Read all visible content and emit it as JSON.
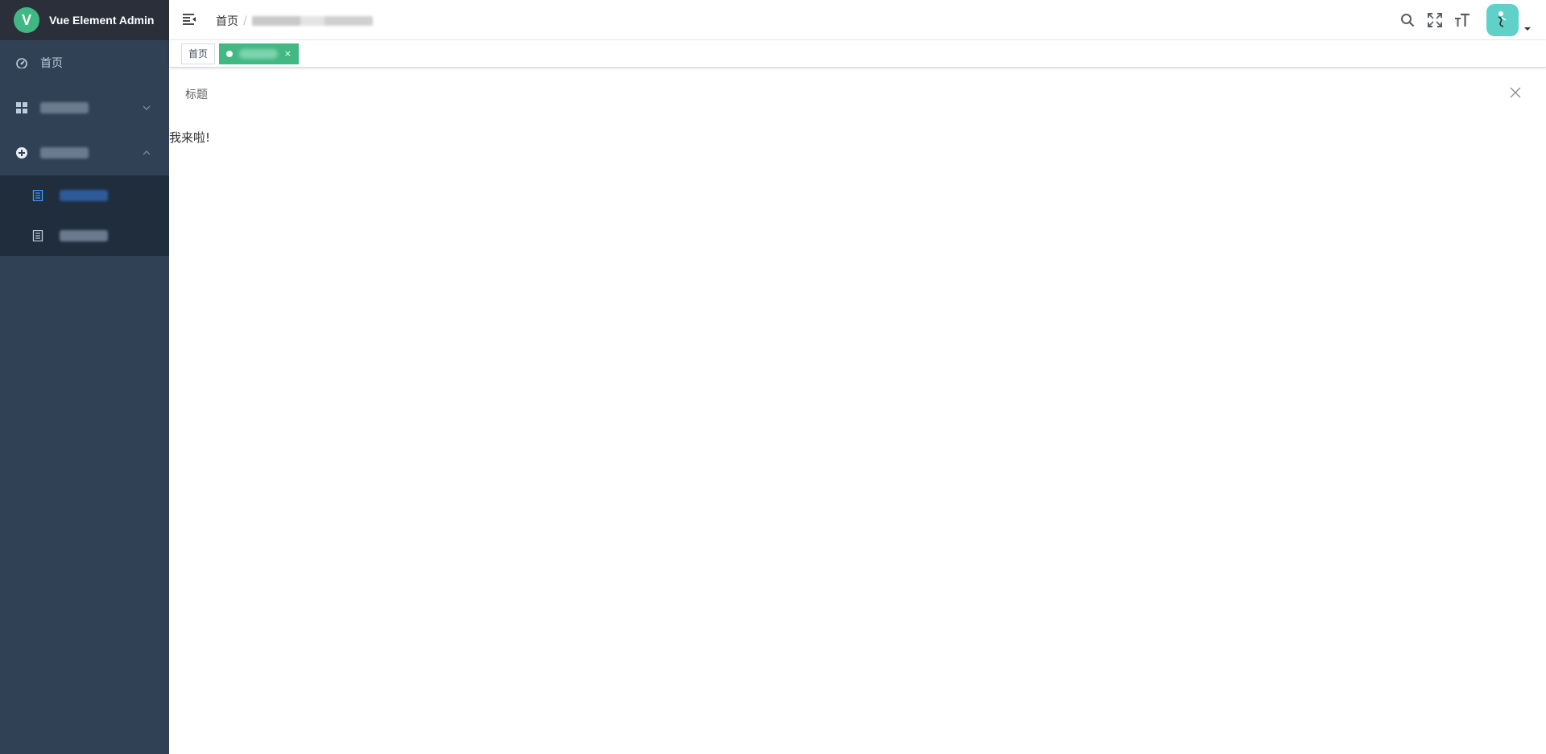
{
  "app": {
    "title": "Vue Element Admin",
    "logo_letter": "V"
  },
  "sidebar": {
    "items": [
      {
        "label": "首页",
        "icon": "dashboard-icon"
      },
      {
        "label": "",
        "icon": "grid-icon",
        "expanded": false
      },
      {
        "label": "",
        "icon": "component-icon",
        "expanded": true
      }
    ],
    "subitems": [
      {
        "label": "",
        "icon": "document-icon",
        "active": true
      },
      {
        "label": "",
        "icon": "document-icon",
        "active": false
      }
    ]
  },
  "navbar": {
    "breadcrumb": {
      "home": "首页",
      "separator": "/"
    },
    "icons": [
      "search-icon",
      "fullscreen-icon",
      "font-size-icon"
    ]
  },
  "tags": {
    "home": "首页",
    "close": "×"
  },
  "content": {
    "title": "标题",
    "body": "我来啦!"
  },
  "colors": {
    "sidebar_bg": "#304156",
    "logo_bg": "#2b2f3a",
    "accent": "#42b983",
    "submenu_bg": "#1f2d3d",
    "active_text": "#409eff"
  }
}
